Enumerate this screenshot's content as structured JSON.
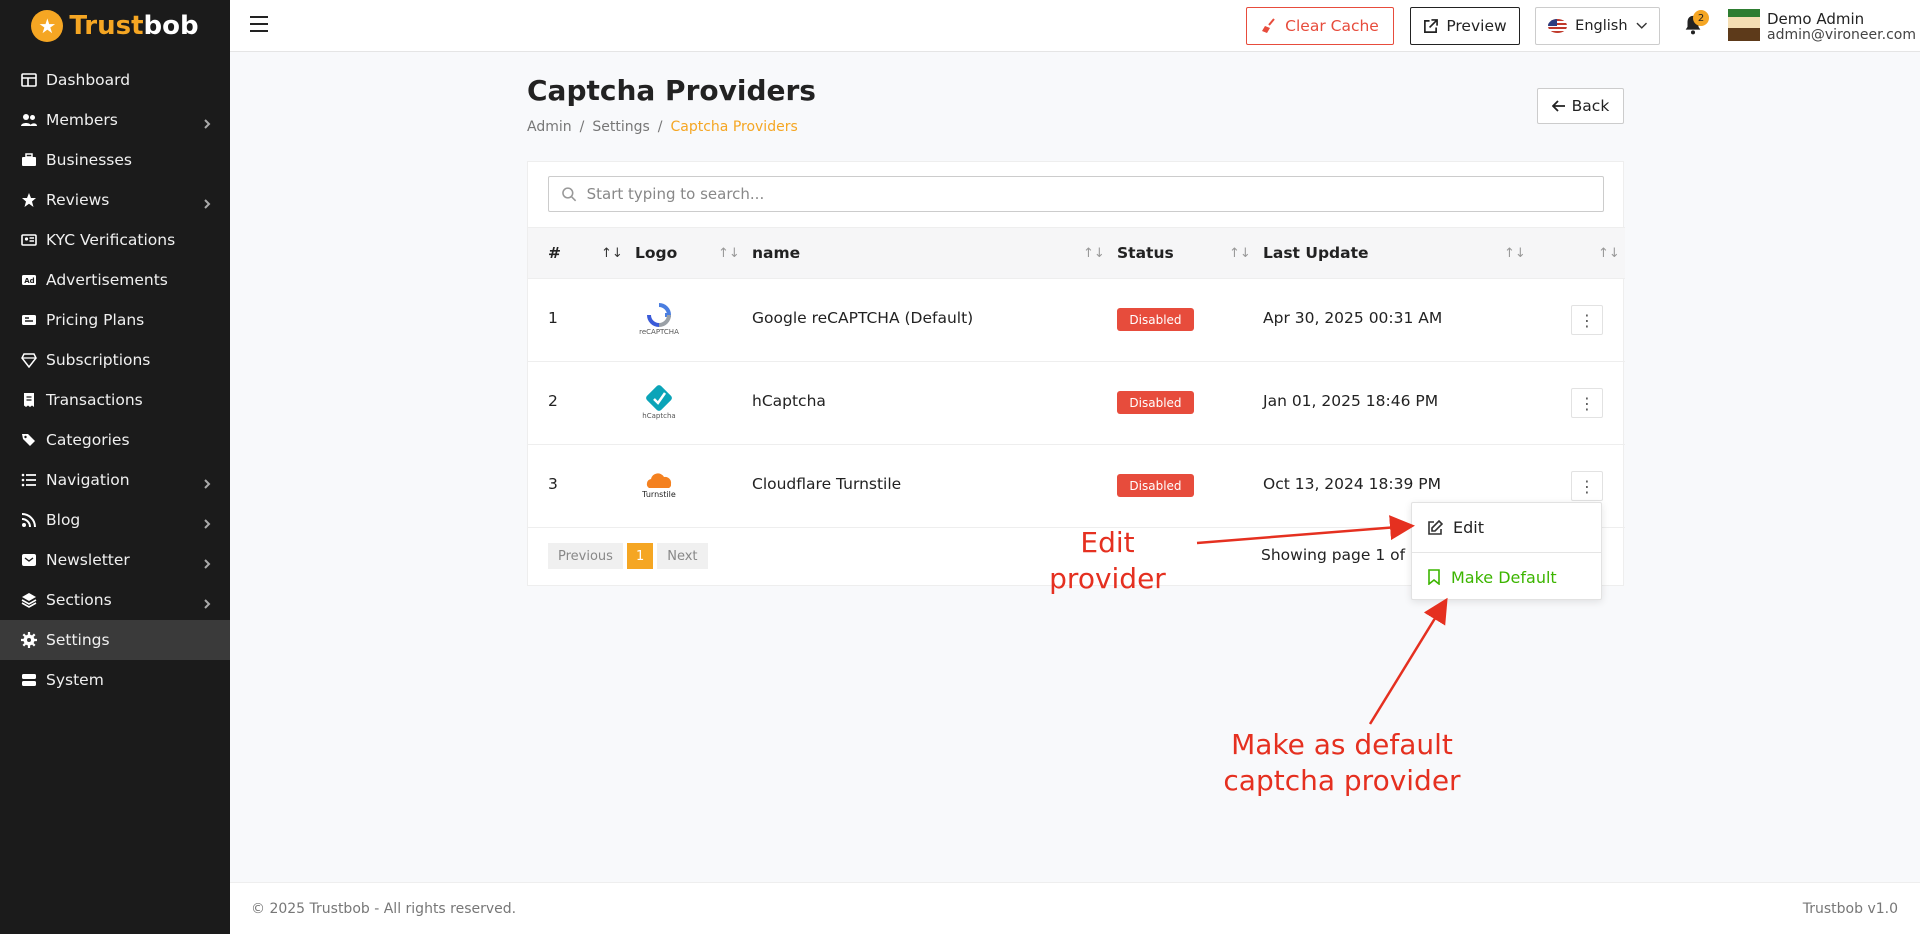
{
  "brand": {
    "part1": "Trust",
    "part2": "bob",
    "accent": "#f5a623"
  },
  "sidebar": {
    "items": [
      {
        "label": "Dashboard",
        "icon": "dashboard-icon",
        "chevron": false
      },
      {
        "label": "Members",
        "icon": "users-icon",
        "chevron": true
      },
      {
        "label": "Businesses",
        "icon": "briefcase-icon",
        "chevron": false
      },
      {
        "label": "Reviews",
        "icon": "star-icon",
        "chevron": true
      },
      {
        "label": "KYC Verifications",
        "icon": "id-card-icon",
        "chevron": false
      },
      {
        "label": "Advertisements",
        "icon": "ad-icon",
        "chevron": false
      },
      {
        "label": "Pricing Plans",
        "icon": "pricing-icon",
        "chevron": false
      },
      {
        "label": "Subscriptions",
        "icon": "gem-icon",
        "chevron": false
      },
      {
        "label": "Transactions",
        "icon": "receipt-icon",
        "chevron": false
      },
      {
        "label": "Categories",
        "icon": "tags-icon",
        "chevron": false
      },
      {
        "label": "Navigation",
        "icon": "list-icon",
        "chevron": true
      },
      {
        "label": "Blog",
        "icon": "rss-icon",
        "chevron": true
      },
      {
        "label": "Newsletter",
        "icon": "envelope-icon",
        "chevron": true
      },
      {
        "label": "Sections",
        "icon": "layers-icon",
        "chevron": true
      },
      {
        "label": "Settings",
        "icon": "gear-icon",
        "chevron": false,
        "active": true
      },
      {
        "label": "System",
        "icon": "server-icon",
        "chevron": false
      }
    ]
  },
  "header": {
    "clear_cache": "Clear Cache",
    "preview": "Preview",
    "language": "English",
    "notifications": "2",
    "user_name": "Demo Admin",
    "user_email": "admin@vironeer.com"
  },
  "page": {
    "title": "Captcha Providers",
    "breadcrumb": [
      "Admin",
      "Settings",
      "Captcha Providers"
    ],
    "back": "Back"
  },
  "search": {
    "placeholder": "Start typing to search..."
  },
  "table": {
    "columns": [
      "#",
      "Logo",
      "name",
      "Status",
      "Last Update"
    ],
    "rows": [
      {
        "num": "1",
        "logo_text": "reCAPTCHA",
        "name": "Google reCAPTCHA (Default)",
        "status": "Disabled",
        "updated": "Apr 30, 2025 00:31 AM"
      },
      {
        "num": "2",
        "logo_text": "hCaptcha",
        "name": "hCaptcha",
        "status": "Disabled",
        "updated": "Jan 01, 2025 18:46 PM"
      },
      {
        "num": "3",
        "logo_text": "Turnstile",
        "name": "Cloudflare Turnstile",
        "status": "Disabled",
        "updated": "Oct 13, 2024 18:39 PM"
      }
    ]
  },
  "pager": {
    "prev": "Previous",
    "current": "1",
    "next": "Next",
    "showing": "Showing page 1 of 1"
  },
  "dropdown": {
    "edit": "Edit",
    "make_default": "Make Default"
  },
  "annotations": {
    "edit": "Edit provider",
    "default_line1": "Make as default",
    "default_line2": "captcha provider"
  },
  "footer": {
    "copyright": "© 2025 Trustbob - All rights reserved.",
    "version": "Trustbob v1.0"
  }
}
